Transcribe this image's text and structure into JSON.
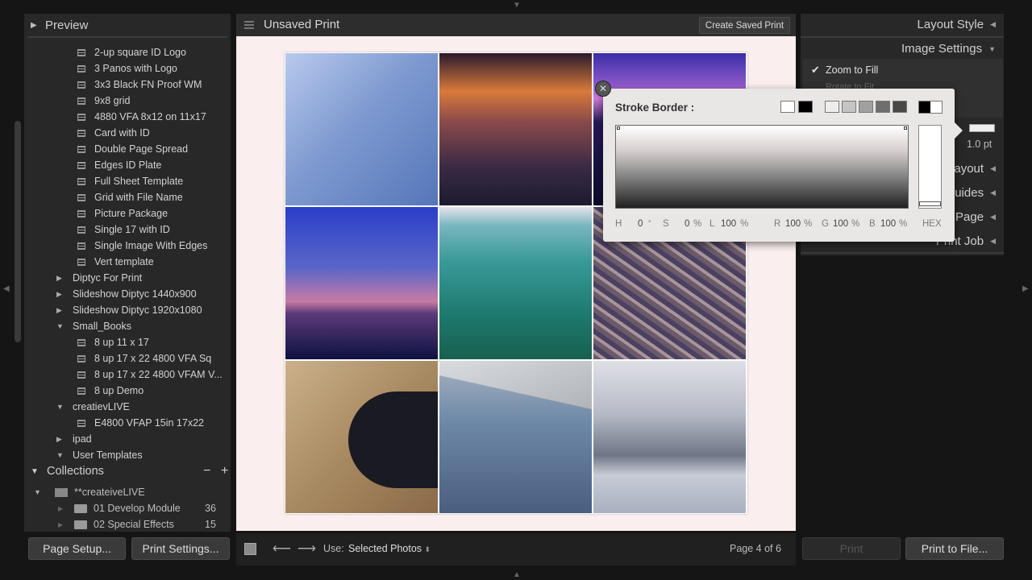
{
  "left_panel": {
    "preview_label": "Preview",
    "templates": [
      {
        "label": "2-up square ID Logo",
        "type": "item"
      },
      {
        "label": "3 Panos with Logo",
        "type": "item"
      },
      {
        "label": "3x3 Black FN Proof WM",
        "type": "item"
      },
      {
        "label": "9x8 grid",
        "type": "item"
      },
      {
        "label": "4880 VFA 8x12 on 11x17",
        "type": "item"
      },
      {
        "label": "Card with ID",
        "type": "item"
      },
      {
        "label": "Double Page Spread",
        "type": "item"
      },
      {
        "label": "Edges ID Plate",
        "type": "item"
      },
      {
        "label": "Full Sheet Template",
        "type": "item"
      },
      {
        "label": "Grid with File Name",
        "type": "item"
      },
      {
        "label": "Picture Package",
        "type": "item"
      },
      {
        "label": "Single 17 with ID",
        "type": "item"
      },
      {
        "label": "Single Image With Edges",
        "type": "item"
      },
      {
        "label": "Vert template",
        "type": "item"
      },
      {
        "label": "Diptyc For Print",
        "type": "folder-closed"
      },
      {
        "label": "Slideshow Diptyc 1440x900",
        "type": "folder-closed"
      },
      {
        "label": "Slideshow Diptyc 1920x1080",
        "type": "folder-closed"
      },
      {
        "label": "Small_Books",
        "type": "folder-open"
      },
      {
        "label": "8 up 11 x 17",
        "type": "item"
      },
      {
        "label": "8 up 17 x 22 4800 VFA Sq",
        "type": "item"
      },
      {
        "label": "8 up 17 x 22 4800 VFAM V...",
        "type": "item"
      },
      {
        "label": "8 up Demo",
        "type": "item"
      },
      {
        "label": "creatievLIVE",
        "type": "folder-open"
      },
      {
        "label": "E4800 VFAP 15in 17x22",
        "type": "item"
      },
      {
        "label": "ipad",
        "type": "folder-closed"
      },
      {
        "label": "User Templates",
        "type": "folder-open"
      }
    ],
    "collections": {
      "label": "Collections",
      "minus": "−",
      "plus": "+",
      "root": "**createiveLIVE",
      "items": [
        {
          "label": "01 Develop Module",
          "count": "36"
        },
        {
          "label": "02 Special Effects",
          "count": "15"
        }
      ]
    },
    "page_setup_label": "Page Setup...",
    "print_settings_label": "Print Settings..."
  },
  "center": {
    "title": "Unsaved Print",
    "create_saved_label": "Create Saved Print",
    "use_label": "Use:",
    "use_value": "Selected Photos",
    "page_info": "Page 4 of 6"
  },
  "right_panel": {
    "layout_style": "Layout Style",
    "image_settings": "Image Settings",
    "zoom_to_fill": "Zoom to Fill",
    "rotate_to_fit": "Rotate to Fit",
    "stroke_value": "1.0 pt",
    "layout": "Layout",
    "guides": "Guides",
    "page": "Page",
    "print_job": "Print Job",
    "print_label": "Print",
    "print_to_file_label": "Print to File..."
  },
  "color_picker": {
    "title": "Stroke Border :",
    "fields": [
      {
        "label": "H",
        "value": "0",
        "unit": "°"
      },
      {
        "label": "S",
        "value": "0",
        "unit": "%"
      },
      {
        "label": "L",
        "value": "100",
        "unit": "%"
      },
      {
        "label": "R",
        "value": "100",
        "unit": "%"
      },
      {
        "label": "G",
        "value": "100",
        "unit": "%"
      },
      {
        "label": "B",
        "value": "100",
        "unit": "%"
      }
    ],
    "hex_label": "HEX",
    "swatches": [
      "#ffffff",
      "#000000",
      "#eeeeee",
      "#c4c4c4",
      "#a0a0a0",
      "#6e6e6e",
      "#484848"
    ]
  },
  "icons": [
    "disclosure-triangle",
    "template-icon",
    "folder-icon",
    "close-icon",
    "left-arrow-icon",
    "right-arrow-icon",
    "checkbox-icon"
  ]
}
